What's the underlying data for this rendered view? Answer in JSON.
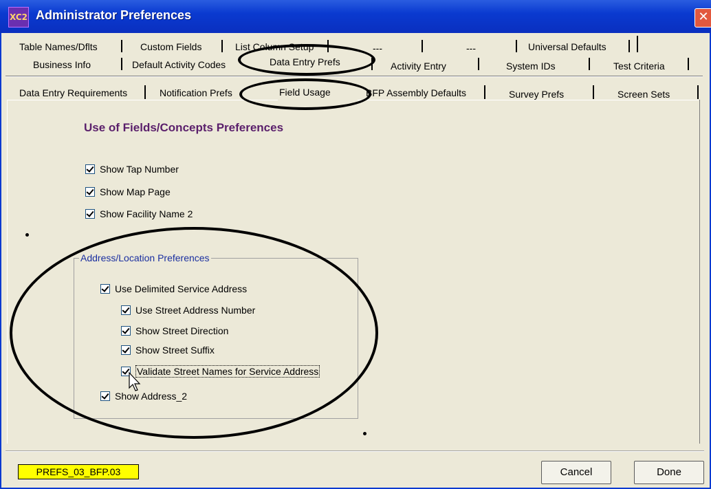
{
  "window": {
    "title": "Administrator Preferences",
    "app_icon": "XC2",
    "close_glyph": "✕"
  },
  "tabs_row1": [
    "Table Names/Dflts",
    "Custom Fields",
    "List Column Setup",
    "---",
    "---",
    "Universal Defaults"
  ],
  "tabs_row2": [
    "Business Info",
    "Default Activity Codes",
    "Data Entry Prefs",
    "Activity Entry",
    "System IDs",
    "Test Criteria"
  ],
  "tabs_row3": [
    "Data Entry Requirements",
    "Notification Prefs",
    "Field Usage",
    "BFP Assembly Defaults",
    "Survey Prefs",
    "Screen Sets"
  ],
  "panel": {
    "heading": "Use of Fields/Concepts Preferences",
    "checks": [
      {
        "label": "Show Tap Number",
        "checked": true
      },
      {
        "label": "Show Map Page",
        "checked": true
      },
      {
        "label": "Show Facility Name 2",
        "checked": true
      }
    ],
    "group": {
      "label": "Address/Location Preferences",
      "main_check": {
        "label": "Use Delimited Service Address",
        "checked": true
      },
      "sub_checks": [
        {
          "label": "Use Street Address Number",
          "checked": true
        },
        {
          "label": "Show Street Direction",
          "checked": true
        },
        {
          "label": "Show Street Suffix",
          "checked": true
        },
        {
          "label": "Validate Street Names for Service Address",
          "checked": true
        }
      ],
      "last_check": {
        "label": "Show Address_2",
        "checked": true
      }
    }
  },
  "footer": {
    "screen_id": "PREFS_03_BFP.03",
    "cancel": "Cancel",
    "done": "Done"
  },
  "colors": {
    "title_bar": "#0a3ad0",
    "window_bg": "#ece9d8",
    "heading": "#5a1f6b",
    "group_label": "#1a2fa0",
    "screen_id_bg": "#ffff00"
  }
}
